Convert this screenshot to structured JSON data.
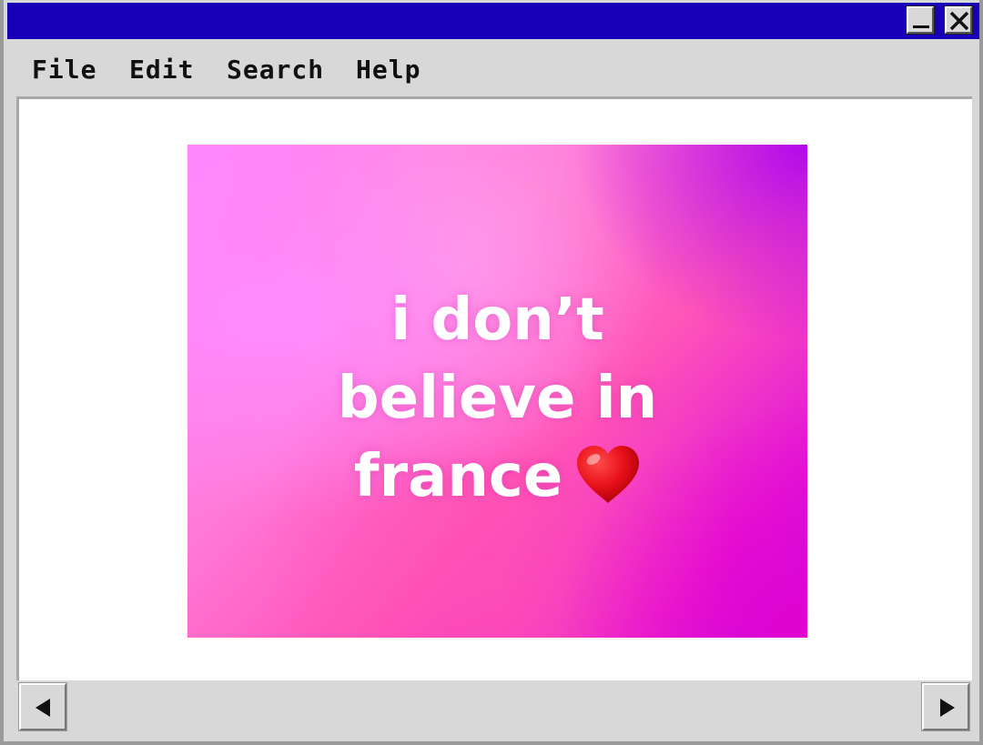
{
  "window": {
    "minimize_glyph": "_",
    "close_glyph": "X"
  },
  "menu": {
    "file": "File",
    "edit": "Edit",
    "search": "Search",
    "help": "Help"
  },
  "content": {
    "meme": {
      "lines": [
        "i don’t",
        "believe in",
        "france"
      ],
      "emoji": "heart-icon"
    }
  },
  "colors": {
    "titlebar": "#1800b8",
    "chrome": "#d8d8d8",
    "meme_pink": "#ff7ad8",
    "meme_purple": "#b010f0",
    "heart": "#e8101a"
  }
}
